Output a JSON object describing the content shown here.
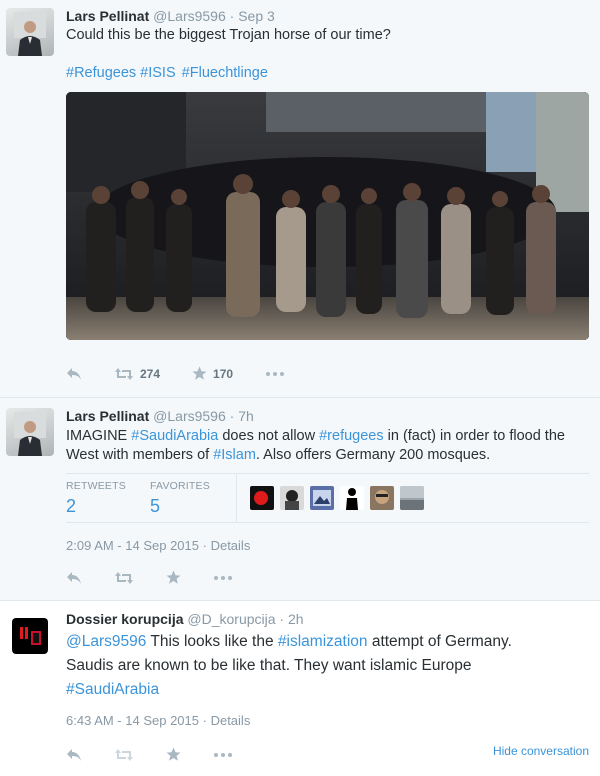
{
  "tweets": [
    {
      "fullname": "Lars Pellinat",
      "handle": "@Lars9596",
      "time": "Sep 3",
      "text": "Could this be the biggest Trojan horse of our time?",
      "hashtags": [
        "#Refugees",
        "#ISIS",
        "#Fluechtlinge"
      ],
      "actions": {
        "retweets": "274",
        "favorites": "170"
      }
    },
    {
      "fullname": "Lars Pellinat",
      "handle": "@Lars9596",
      "time": "7h",
      "text_parts": [
        "IMAGINE ",
        "#SaudiArabia",
        " does not allow ",
        "#refugees",
        " in (fact) in order to flood the West with members of ",
        "#Islam",
        ". Also offers Germany 200 mosques."
      ],
      "stats": {
        "retweets_label": "RETWEETS",
        "retweets": "2",
        "favorites_label": "FAVORITES",
        "favorites": "5"
      },
      "timestamp": "2:09 AM - 14 Sep 2015",
      "details": "Details"
    },
    {
      "fullname": "Dossier korupcija",
      "handle": "@D_korupcija",
      "time": "2h",
      "text_parts": [
        "@Lars9596",
        " This looks like the ",
        "#islamization",
        " attempt of Germany. Saudis are known to be like that. They want islamic Europe ",
        "#SaudiArabia"
      ],
      "timestamp": "6:43 AM - 14 Sep 2015",
      "details": "Details",
      "hide_conversation": "Hide conversation"
    }
  ],
  "separator": "·",
  "icons": [
    "reply-icon",
    "retweet-icon",
    "favorite-icon",
    "more-icon"
  ],
  "colors": {
    "link": "#3b94d9",
    "muted": "#8899a6",
    "text": "#292f33"
  }
}
